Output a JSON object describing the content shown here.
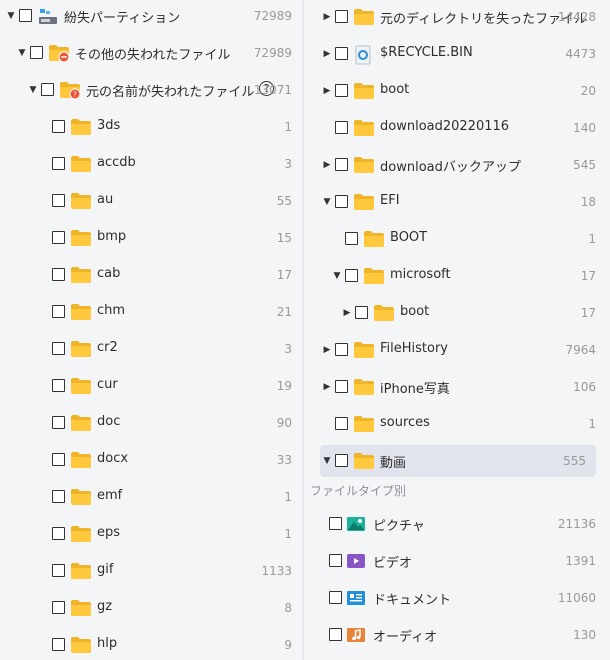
{
  "left_tree": [
    {
      "label": "紛失パーティション",
      "count": "72989",
      "icon": "partition-icon",
      "arrow": "down",
      "level": 0
    },
    {
      "label": "その他の失われたファイル",
      "count": "72989",
      "icon": "folder-lost-icon",
      "arrow": "down",
      "level": 1
    },
    {
      "label": "元の名前が失われたファイル",
      "count": "13071",
      "icon": "folder-unknown-icon",
      "arrow": "down",
      "level": 2,
      "help": "?"
    },
    {
      "label": "3ds",
      "count": "1",
      "icon": "folder-icon",
      "level": 3
    },
    {
      "label": "accdb",
      "count": "3",
      "icon": "folder-icon",
      "level": 3
    },
    {
      "label": "au",
      "count": "55",
      "icon": "folder-icon",
      "level": 3
    },
    {
      "label": "bmp",
      "count": "15",
      "icon": "folder-icon",
      "level": 3
    },
    {
      "label": "cab",
      "count": "17",
      "icon": "folder-icon",
      "level": 3
    },
    {
      "label": "chm",
      "count": "21",
      "icon": "folder-icon",
      "level": 3
    },
    {
      "label": "cr2",
      "count": "3",
      "icon": "folder-icon",
      "level": 3
    },
    {
      "label": "cur",
      "count": "19",
      "icon": "folder-icon",
      "level": 3
    },
    {
      "label": "doc",
      "count": "90",
      "icon": "folder-icon",
      "level": 3
    },
    {
      "label": "docx",
      "count": "33",
      "icon": "folder-icon",
      "level": 3
    },
    {
      "label": "emf",
      "count": "1",
      "icon": "folder-icon",
      "level": 3
    },
    {
      "label": "eps",
      "count": "1",
      "icon": "folder-icon",
      "level": 3
    },
    {
      "label": "gif",
      "count": "1133",
      "icon": "folder-icon",
      "level": 3
    },
    {
      "label": "gz",
      "count": "8",
      "icon": "folder-icon",
      "level": 3
    },
    {
      "label": "hlp",
      "count": "9",
      "icon": "folder-icon",
      "level": 3
    }
  ],
  "right_tree": [
    {
      "label": "元のディレクトリを失ったファイル",
      "count": "14428",
      "icon": "folder-icon",
      "arrow": "right",
      "level": 0
    },
    {
      "label": "$RECYCLE.BIN",
      "count": "4473",
      "icon": "recycle-bin-icon",
      "arrow": "right",
      "level": 0
    },
    {
      "label": "boot",
      "count": "20",
      "icon": "folder-icon",
      "arrow": "right",
      "level": 0
    },
    {
      "label": "download20220116",
      "count": "140",
      "icon": "folder-icon",
      "level": 0
    },
    {
      "label": "downloadバックアップ",
      "count": "545",
      "icon": "folder-icon",
      "arrow": "right",
      "level": 0
    },
    {
      "label": "EFI",
      "count": "18",
      "icon": "folder-icon",
      "arrow": "down",
      "level": 0
    },
    {
      "label": "BOOT",
      "count": "1",
      "icon": "folder-icon",
      "level": 1
    },
    {
      "label": "microsoft",
      "count": "17",
      "icon": "folder-icon",
      "arrow": "down",
      "level": 1
    },
    {
      "label": "boot",
      "count": "17",
      "icon": "folder-icon",
      "arrow": "right",
      "level": 2
    },
    {
      "label": "FileHistory",
      "count": "7964",
      "icon": "folder-icon",
      "arrow": "right",
      "level": 0
    },
    {
      "label": "iPhone写真",
      "count": "106",
      "icon": "folder-icon",
      "arrow": "right",
      "level": 0
    },
    {
      "label": "sources",
      "count": "1",
      "icon": "folder-icon",
      "level": 0
    },
    {
      "label": "動画",
      "count": "555",
      "icon": "folder-icon",
      "arrow": "down",
      "level": 0,
      "selected": true
    }
  ],
  "filetype_section": {
    "title": "ファイルタイプ別",
    "items": [
      {
        "label": "ピクチャ",
        "count": "21136",
        "icon": "picture-icon"
      },
      {
        "label": "ビデオ",
        "count": "1391",
        "icon": "video-icon"
      },
      {
        "label": "ドキュメント",
        "count": "11060",
        "icon": "document-icon"
      },
      {
        "label": "オーディオ",
        "count": "130",
        "icon": "audio-icon"
      }
    ]
  },
  "colors": {
    "folder": "#ffc83d",
    "folder_dark": "#f0b429",
    "selected_bg": "#e1e4ec",
    "count": "#999999",
    "picture": "#1bb19b",
    "video": "#8a56c7",
    "document": "#1e8fd8",
    "audio": "#e8833a"
  }
}
